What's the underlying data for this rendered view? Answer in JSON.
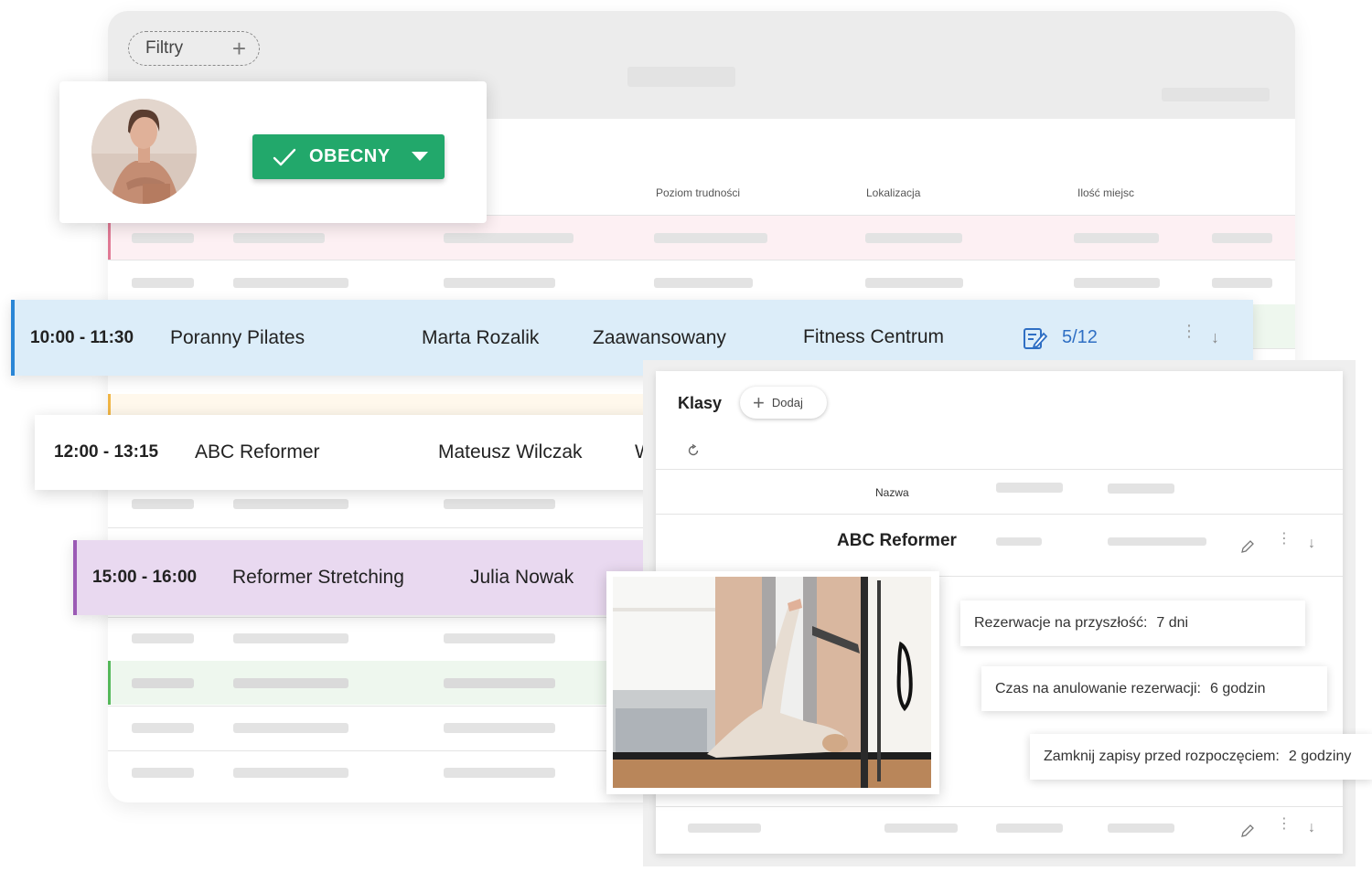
{
  "filters": {
    "label": "Filtry"
  },
  "table": {
    "columns": [
      "Poziom trudności",
      "Lokalizacja",
      "Ilość miejsc"
    ]
  },
  "instructor_card": {
    "status": "OBECNY"
  },
  "classes": [
    {
      "time": "10:00 - 11:30",
      "name": "Poranny Pilates",
      "instructor": "Marta Rozalik",
      "level": "Zaawansowany",
      "location": "Fitness Centrum",
      "spots": "5/12"
    },
    {
      "time": "12:00 - 13:15",
      "name": "ABC Reformer",
      "instructor": "Mateusz Wilczak",
      "level_partial": "W"
    },
    {
      "time": "15:00 - 16:00",
      "name": "Reformer Stretching",
      "instructor": "Julia Nowak"
    }
  ],
  "klasy_panel": {
    "title": "Klasy",
    "add_label": "Dodaj",
    "column_name": "Nazwa",
    "row_name": "ABC Reformer",
    "settings": [
      {
        "label": "Rezerwacje na przyszłość:",
        "value": "7 dni"
      },
      {
        "label": "Czas na anulowanie rezerwacji:",
        "value": "6 godzin"
      },
      {
        "label": "Zamknij zapisy przed rozpoczęciem:",
        "value": "2 godziny"
      }
    ]
  },
  "colors": {
    "status_green": "#22a86b",
    "row_blue_bg": "#dcedf9",
    "row_blue_accent": "#2a86d6",
    "row_purple_bg": "#e9d9f0",
    "row_purple_accent": "#9b5bb5",
    "spots_blue": "#2f6fc4"
  },
  "icons": [
    "plus-icon",
    "check-icon",
    "caret-down-icon",
    "notes-icon",
    "more-vertical-icon",
    "arrow-down-icon",
    "refresh-icon",
    "pencil-icon"
  ]
}
